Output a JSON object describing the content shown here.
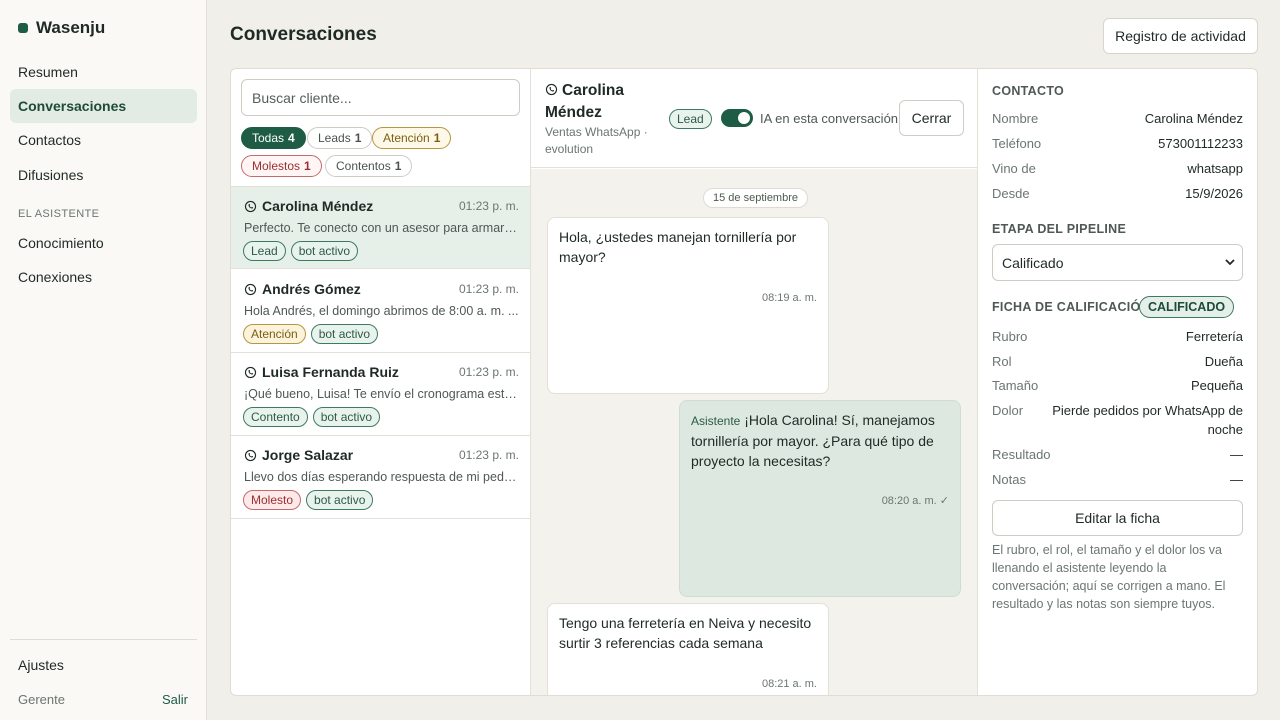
{
  "app": {
    "name": "Wasenju",
    "brand_color": "#1e5c45"
  },
  "sidebar": {
    "items": [
      {
        "label": "Resumen"
      },
      {
        "label": "Conversaciones",
        "active": true
      },
      {
        "label": "Contactos"
      },
      {
        "label": "Difusiones"
      }
    ],
    "section_label": "EL ASISTENTE",
    "assistant_items": [
      {
        "label": "Conocimiento"
      },
      {
        "label": "Conexiones"
      }
    ],
    "settings_label": "Ajustes",
    "user_label": "Gerente",
    "logout_label": "Salir"
  },
  "header": {
    "title": "Conversaciones",
    "activity_button": "Registro de actividad"
  },
  "search": {
    "placeholder": "Buscar cliente..."
  },
  "filters": [
    {
      "label": "Todas",
      "count": "4",
      "selected": true
    },
    {
      "label": "Leads",
      "count": "1"
    },
    {
      "label": "Atención",
      "count": "1"
    },
    {
      "label": "Molestos",
      "count": "1"
    },
    {
      "label": "Contentos",
      "count": "1"
    }
  ],
  "conversations": [
    {
      "name": "Carolina Méndez",
      "time": "01:23 p. m.",
      "preview": "Perfecto. Te conecto con un asesor para armar e...",
      "tags": [
        "Lead",
        "bot activo"
      ],
      "active": true
    },
    {
      "name": "Andrés Gómez",
      "time": "01:23 p. m.",
      "preview": "Hola Andrés, el domingo abrimos de 8:00 a. m. ...",
      "tags": [
        "Atención",
        "bot activo"
      ]
    },
    {
      "name": "Luisa Fernanda Ruiz",
      "time": "01:23 p. m.",
      "preview": "¡Qué bueno, Luisa! Te envío el cronograma esta ...",
      "tags": [
        "Contento",
        "bot activo"
      ]
    },
    {
      "name": "Jorge Salazar",
      "time": "01:23 p. m.",
      "preview": "Llevo dos días esperando respuesta de mi pedido",
      "tags": [
        "Molesto",
        "bot activo"
      ]
    }
  ],
  "chat": {
    "contact_name": "Carolina Méndez",
    "channel": "Ventas WhatsApp · evolution",
    "status_pill": "Lead",
    "ai_toggle_label": "IA en esta conversación",
    "ai_enabled": true,
    "close_button": "Cerrar",
    "date_separator": "15 de septiembre",
    "messages": [
      {
        "direction": "in",
        "text": "Hola, ¿ustedes manejan tornillería por mayor?",
        "time": "08:19 a. m."
      },
      {
        "direction": "out",
        "sender": "Asistente",
        "text": "¡Hola Carolina! Sí, manejamos tornillería por mayor. ¿Para qué tipo de proyecto la necesitas?",
        "time": "08:20 a. m. ✓"
      },
      {
        "direction": "in",
        "text": "Tengo una ferretería en Neiva y necesito surtir 3 referencias cada semana",
        "time": "08:21 a. m."
      }
    ]
  },
  "contact": {
    "title": "CONTACTO",
    "fields": [
      {
        "key": "Nombre",
        "value": "Carolina Méndez"
      },
      {
        "key": "Teléfono",
        "value": "573001112233"
      },
      {
        "key": "Vino de",
        "value": "whatsapp"
      },
      {
        "key": "Desde",
        "value": "15/9/2026"
      }
    ],
    "pipeline_title": "ETAPA DEL PIPELINE",
    "pipeline_value": "Calificado",
    "qual_title": "FICHA DE CALIFICACIÓN",
    "qual_badge": "CALIFICADO",
    "qual_fields": [
      {
        "key": "Rubro",
        "value": "Ferretería"
      },
      {
        "key": "Rol",
        "value": "Dueña"
      },
      {
        "key": "Tamaño",
        "value": "Pequeña"
      },
      {
        "key": "Dolor",
        "value": "Pierde pedidos por WhatsApp de noche"
      },
      {
        "key": "Resultado",
        "value": "—"
      },
      {
        "key": "Notas",
        "value": "—"
      }
    ],
    "edit_button": "Editar la ficha",
    "help_text": "El rubro, el rol, el tamaño y el dolor los va llenando el asistente leyendo la conversación; aquí se corrigen a mano. El resultado y las notas son siempre tuyos."
  }
}
